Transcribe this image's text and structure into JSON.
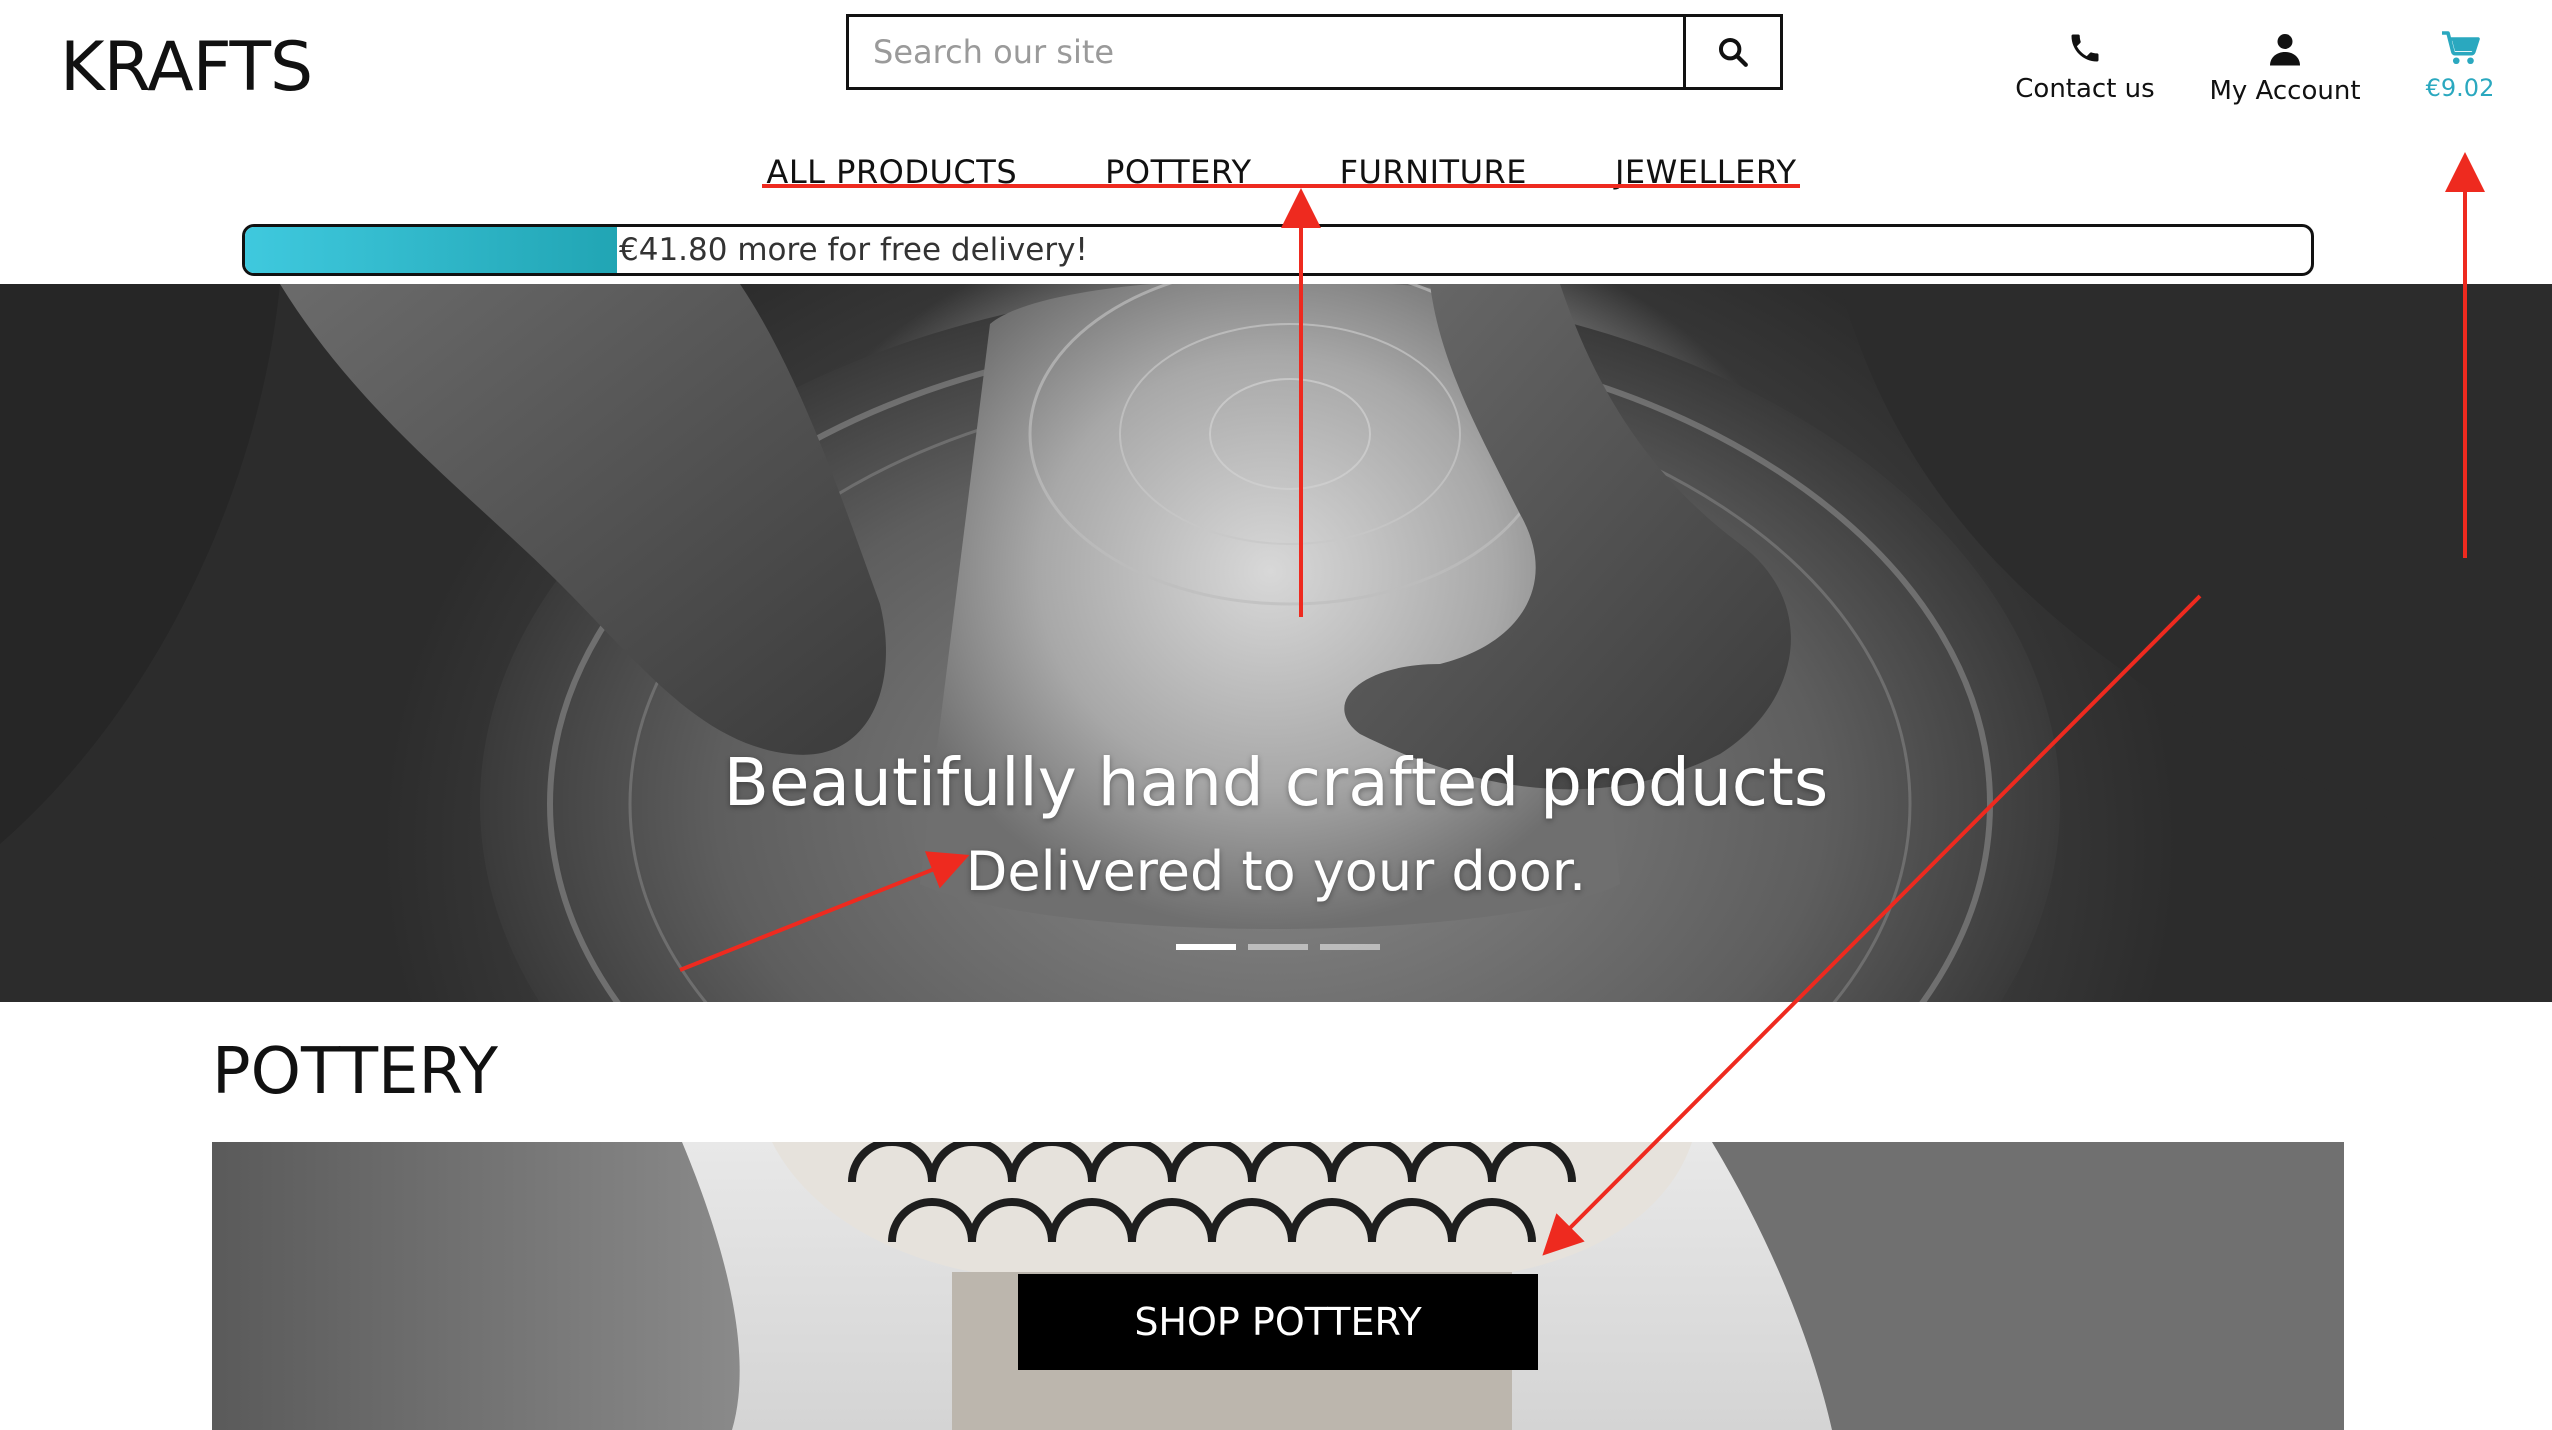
{
  "header": {
    "logo": "KRAFTS",
    "search": {
      "placeholder": "Search our site",
      "icon": "search-icon"
    },
    "contact": {
      "label": "Contact us",
      "icon": "phone-icon"
    },
    "account": {
      "label": "My Account",
      "icon": "user-icon"
    },
    "cart": {
      "total": "€9.02",
      "icon": "shopping-cart-icon",
      "color": "#2aa8bf"
    }
  },
  "nav": {
    "items": [
      {
        "label": "ALL PRODUCTS"
      },
      {
        "label": "POTTERY"
      },
      {
        "label": "FURNITURE"
      },
      {
        "label": "JEWELLERY"
      }
    ]
  },
  "delivery": {
    "message": "€41.80 more for free delivery!",
    "progress_fraction": 0.18,
    "gradient_start": "#3fc9de",
    "gradient_end": "#21a5b4"
  },
  "hero": {
    "title": "Beautifully hand crafted products",
    "subtitle": "Delivered to your door.",
    "slides_count": 3,
    "active_slide": 1
  },
  "pottery": {
    "heading": "POTTERY",
    "button_label": "SHOP POTTERY"
  },
  "annotations": {
    "color": "#ee2a1f"
  }
}
